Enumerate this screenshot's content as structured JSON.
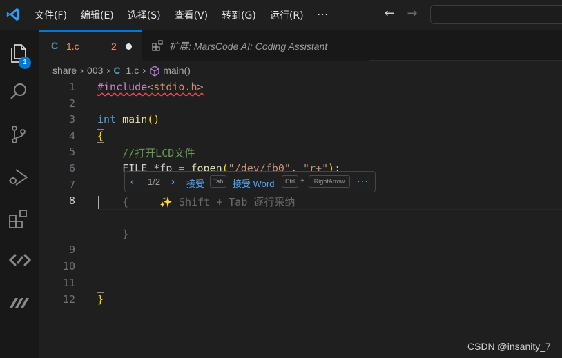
{
  "menu": [
    "文件(F)",
    "编辑(E)",
    "选择(S)",
    "查看(V)",
    "转到(G)",
    "运行(R)",
    "···"
  ],
  "navigation": {
    "back_icon": "arrow-left-icon",
    "forward_icon": "arrow-right-icon"
  },
  "activity_bar": {
    "items": [
      "explorer-icon",
      "search-icon",
      "source-control-icon",
      "run-debug-icon",
      "extensions-icon",
      "marscode-icon",
      "marscode-ai-icon"
    ],
    "explorer_badge": "1"
  },
  "tabs": [
    {
      "icon_text": "C",
      "name": "1.c",
      "problems": "2"
    },
    {
      "name": "扩展: MarsCode AI: Coding Assistant"
    }
  ],
  "breadcrumb": {
    "folder1": "share",
    "folder2": "003",
    "file_icon": "C",
    "file": "1.c",
    "symbol": "main()"
  },
  "editor": {
    "line_numbers": [
      "1",
      "2",
      "3",
      "4",
      "5",
      "6",
      "7",
      "8",
      "9",
      "10",
      "11",
      "12"
    ],
    "code": {
      "l1_directive": "#include",
      "l1_header": "<stdio.h>",
      "l3_type": "int",
      "l3_func": "main",
      "l3_parens": "()",
      "l4_brace": "{",
      "l5_comment": "//打开LCD文件",
      "l6_prefix": "FILE *fp = ",
      "l6_func": "fopen",
      "l6_str1": "\"/dev/fb0\"",
      "l6_str2": "\"r+\"",
      "l8_ghost_brace": "{",
      "l8_hint": "Shift + Tab 逐行采纳",
      "l8_sparkle": "✨",
      "ghost_close_brace": "}",
      "l12_brace": "}"
    }
  },
  "inline_suggestion": {
    "counter": "1/2",
    "accept_label": "接受",
    "accept_key": "Tab",
    "accept_word_label": "接受 Word",
    "ctrl_key": "Ctrl",
    "plus": "+",
    "right_key": "RightArrow",
    "more": "···"
  },
  "watermark": "CSDN @insanity_7",
  "colors": {
    "accent": "#0078d4",
    "error": "#f48771",
    "link": "#4daafc",
    "background": "#1f1f1f"
  }
}
